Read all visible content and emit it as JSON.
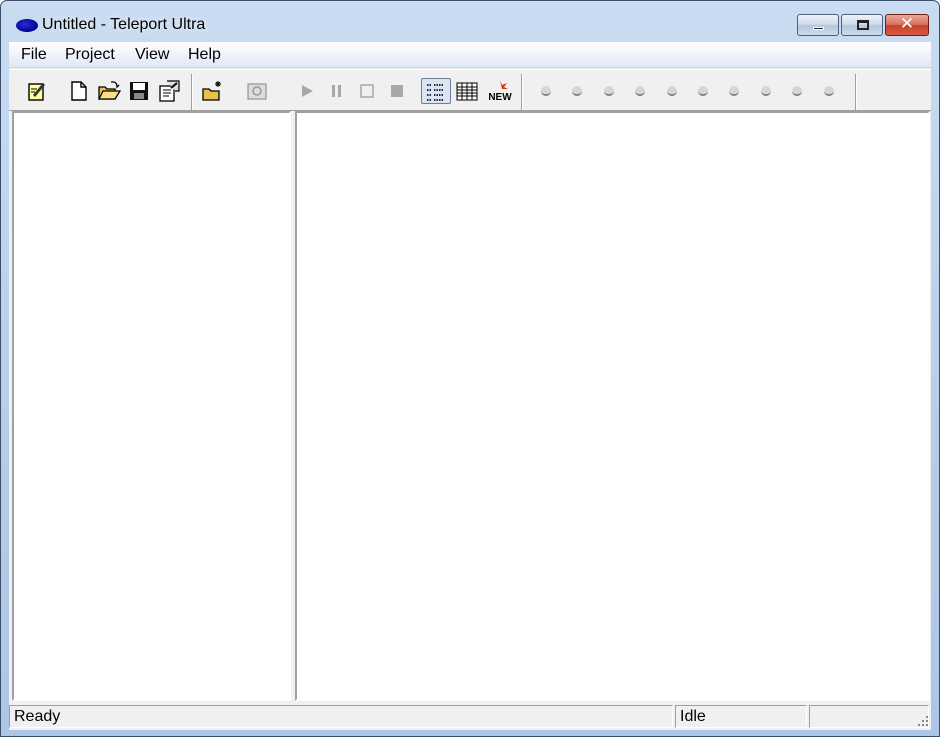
{
  "window": {
    "title": "Untitled - Teleport Ultra"
  },
  "menu": [
    "File",
    "Project",
    "View",
    "Help"
  ],
  "toolbar": {
    "buttons": [
      {
        "name": "new-project-wizard-icon",
        "enabled": true
      },
      {
        "name": "new-file-icon",
        "enabled": true
      },
      {
        "name": "open-folder-icon",
        "enabled": true
      },
      {
        "name": "save-disk-icon",
        "enabled": true
      },
      {
        "name": "properties-icon",
        "enabled": true
      },
      {
        "name": "new-address-icon",
        "enabled": true
      },
      {
        "name": "browse-icon",
        "enabled": false
      },
      {
        "name": "start-icon",
        "enabled": false
      },
      {
        "name": "pause-icon",
        "enabled": false
      },
      {
        "name": "stop-icon",
        "enabled": false
      },
      {
        "name": "abort-icon",
        "enabled": false
      },
      {
        "name": "tree-view-icon",
        "enabled": true,
        "pressed": true
      },
      {
        "name": "detail-view-icon",
        "enabled": true
      },
      {
        "name": "new-badge-icon",
        "enabled": true
      }
    ],
    "new_badge": "NEW",
    "thread_indicators": 10
  },
  "status": {
    "left": "Ready",
    "middle": "Idle",
    "right": ""
  },
  "colors": {
    "accent": "#00008e",
    "close_red": "#c7402b",
    "face": "#f0f0f0"
  }
}
